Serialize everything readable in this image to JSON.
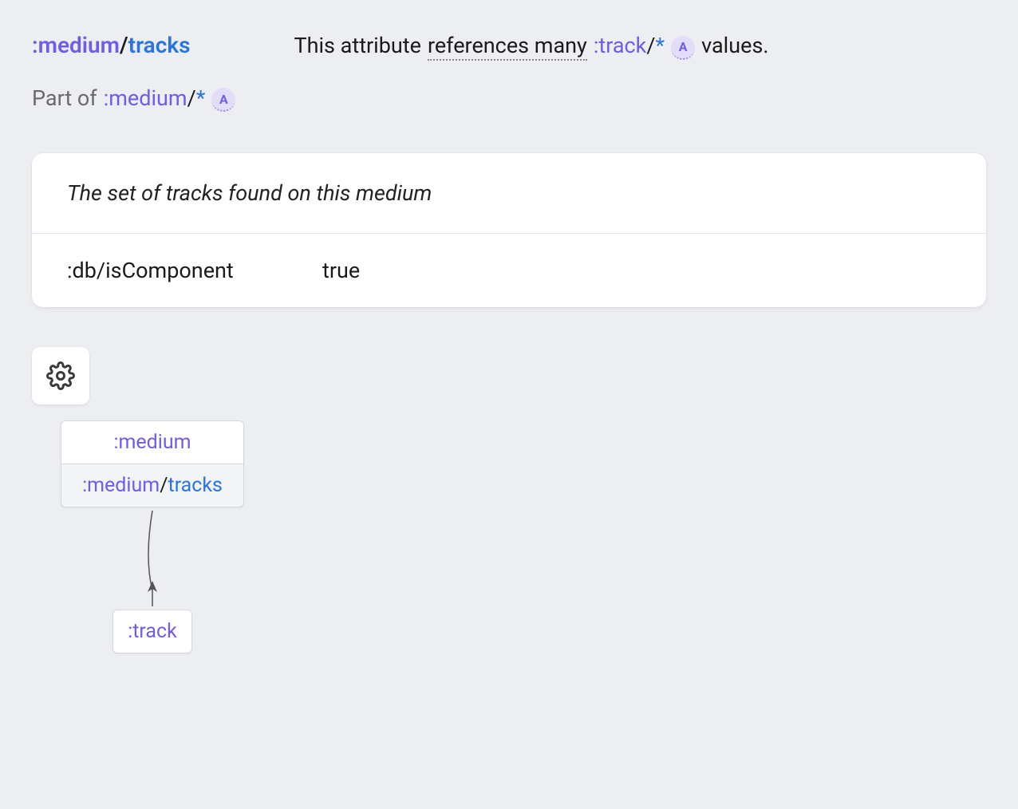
{
  "header": {
    "attribute": {
      "ns": ":medium",
      "slash": "/",
      "name": "tracks"
    },
    "description": {
      "prefix": "This attribute",
      "refs_text": "references many",
      "ref_target": {
        "ns": ":track",
        "wild": "*"
      },
      "badge": "A",
      "suffix": "values."
    }
  },
  "partof": {
    "label": "Part of",
    "ref": {
      "ns": ":medium",
      "wild": "*"
    },
    "badge": "A"
  },
  "card": {
    "doc": "The set of tracks found on this medium",
    "prop_key": ":db/isComponent",
    "prop_val": "true"
  },
  "diagram": {
    "top": ":medium",
    "mid": {
      "ns": ":medium",
      "slash": "/",
      "name": "tracks"
    },
    "bottom": ":track"
  }
}
